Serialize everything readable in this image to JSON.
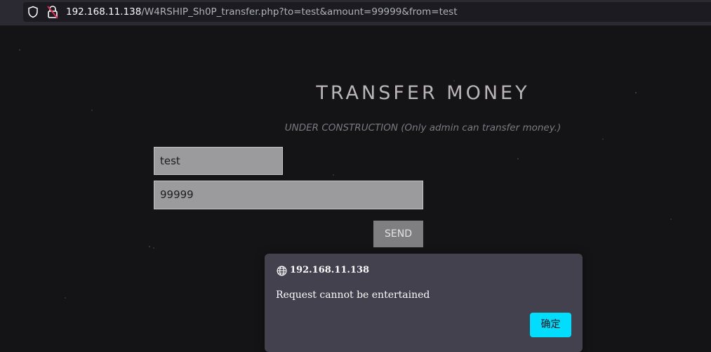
{
  "browser": {
    "url_host": "192.168.11.138",
    "url_path": "/W4RSHIP_Sh0P_transfer.php?to=test&amount=99999&from=test"
  },
  "page": {
    "title": "TRANSFER MONEY",
    "subtitle": "UNDER CONSTRUCTION (Only admin can transfer money.)",
    "to_value": "test",
    "amount_value": "99999",
    "send_label": "SEND"
  },
  "dialog": {
    "origin": "192.168.11.138",
    "message": "Request cannot be entertained",
    "ok_label": "确定"
  },
  "colors": {
    "background": "#141316",
    "dialog_bg": "#42414d",
    "ok_button": "#00ddff"
  }
}
